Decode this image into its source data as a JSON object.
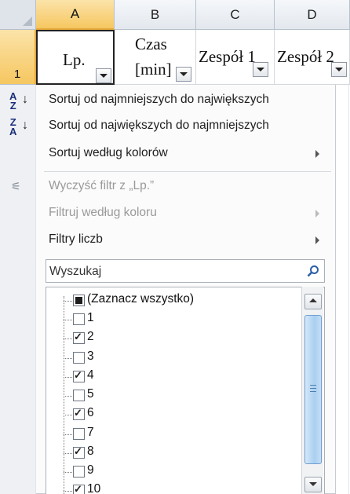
{
  "sheet": {
    "columns": [
      {
        "letter": "A",
        "header": "Lp.",
        "selected": true
      },
      {
        "letter": "B",
        "header_line1": "Czas",
        "header_line2": "[min]"
      },
      {
        "letter": "C",
        "header": "Zespół 1"
      },
      {
        "letter": "D",
        "header": "Zespół 2"
      }
    ],
    "row_number": "1"
  },
  "menu": {
    "sort_asc": "Sortuj od najmniejszych do największych",
    "sort_desc": "Sortuj od największych do najmniejszych",
    "sort_color": "Sortuj według kolorów",
    "clear_filter": "Wyczyść filtr z „Lp.”",
    "filter_color": "Filtruj według koloru",
    "number_filters": "Filtry liczb",
    "icons": {
      "sort_asc": "A\nZ",
      "sort_desc": "Z\nA",
      "clear_filter": "clear-filter-icon"
    }
  },
  "search": {
    "placeholder": "Wyszukaj",
    "icon": "search-icon"
  },
  "filter_list": {
    "items": [
      {
        "label": "(Zaznacz wszystko)",
        "state": "partial"
      },
      {
        "label": "1",
        "state": "unchecked"
      },
      {
        "label": "2",
        "state": "checked"
      },
      {
        "label": "3",
        "state": "unchecked"
      },
      {
        "label": "4",
        "state": "checked"
      },
      {
        "label": "5",
        "state": "unchecked"
      },
      {
        "label": "6",
        "state": "checked"
      },
      {
        "label": "7",
        "state": "unchecked"
      },
      {
        "label": "8",
        "state": "checked"
      },
      {
        "label": "9",
        "state": "unchecked"
      },
      {
        "label": "10",
        "state": "checked"
      }
    ]
  },
  "colors": {
    "selected_header": "#f6c760",
    "scroll_thumb": "#a9cff1",
    "sort_icon": "#1a2e7a"
  }
}
